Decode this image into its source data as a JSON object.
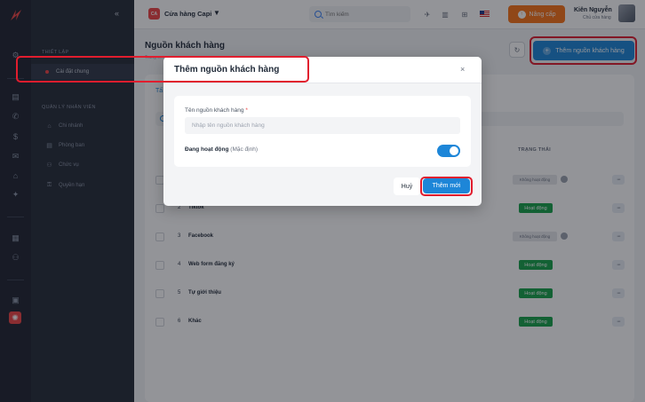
{
  "rail": {
    "icons": [
      "settings-icon",
      "inbox-icon",
      "phone-icon",
      "money-icon",
      "chat-icon",
      "shop-icon",
      "spark-icon",
      "document-icon",
      "org-icon",
      "apps-icon",
      "gear-icon"
    ]
  },
  "sidebar": {
    "collapse_glyph": "«",
    "section1_title": "THIẾT LẬP",
    "section1_items": [
      {
        "label": "Cài đặt chung"
      }
    ],
    "section2_title": "QUẢN LÝ NHÂN VIÊN",
    "section2_items": [
      {
        "label": "Chi nhánh",
        "icon": "branch-icon"
      },
      {
        "label": "Phòng ban",
        "icon": "department-icon"
      },
      {
        "label": "Chức vụ",
        "icon": "position-icon"
      },
      {
        "label": "Quyền hạn",
        "icon": "permission-icon"
      }
    ]
  },
  "topbar": {
    "store_badge": "CA",
    "store_name": "Cửa hàng Capi",
    "search_placeholder": "Tìm kiếm",
    "upgrade_label": "Nâng cấp",
    "user_name": "Kiên Nguyễn",
    "user_role": "Chủ cửa hàng"
  },
  "page": {
    "title": "Nguồn khách hàng",
    "breadcrumb": "Trang c...",
    "add_button_label": "Thêm nguồn khách hàng",
    "tab_label": "Tấ",
    "status_header": "TRẠNG THÁI"
  },
  "table": {
    "rows": [
      {
        "num": "",
        "name": "",
        "status": "Không hoạt động",
        "active": false
      },
      {
        "num": "2",
        "name": "Tiktok",
        "status": "Hoạt động",
        "active": true
      },
      {
        "num": "3",
        "name": "Facebook",
        "status": "Không hoạt động",
        "active": false
      },
      {
        "num": "4",
        "name": "Web form đăng ký",
        "status": "Hoạt động",
        "active": true
      },
      {
        "num": "5",
        "name": "Tự giới thiệu",
        "status": "Hoạt động",
        "active": true
      },
      {
        "num": "6",
        "name": "Khác",
        "status": "Hoạt động",
        "active": true
      }
    ],
    "more_glyph": "···"
  },
  "modal": {
    "title": "Thêm nguồn khách hàng",
    "close_glyph": "×",
    "field_label": "Tên nguồn khách hàng",
    "required_mark": "*",
    "field_placeholder": "Nhập tên nguồn khách hàng",
    "field_value": "",
    "active_label": "Đang hoạt động",
    "active_hint": "(Mặc định)",
    "active_on": true,
    "cancel_label": "Huỷ",
    "submit_label": "Thêm mới"
  },
  "colors": {
    "accent": "#1d86d8",
    "brand": "#ef4444",
    "upgrade": "#f97316",
    "active_badge": "#16a34a",
    "highlight": "#e11d2e"
  }
}
